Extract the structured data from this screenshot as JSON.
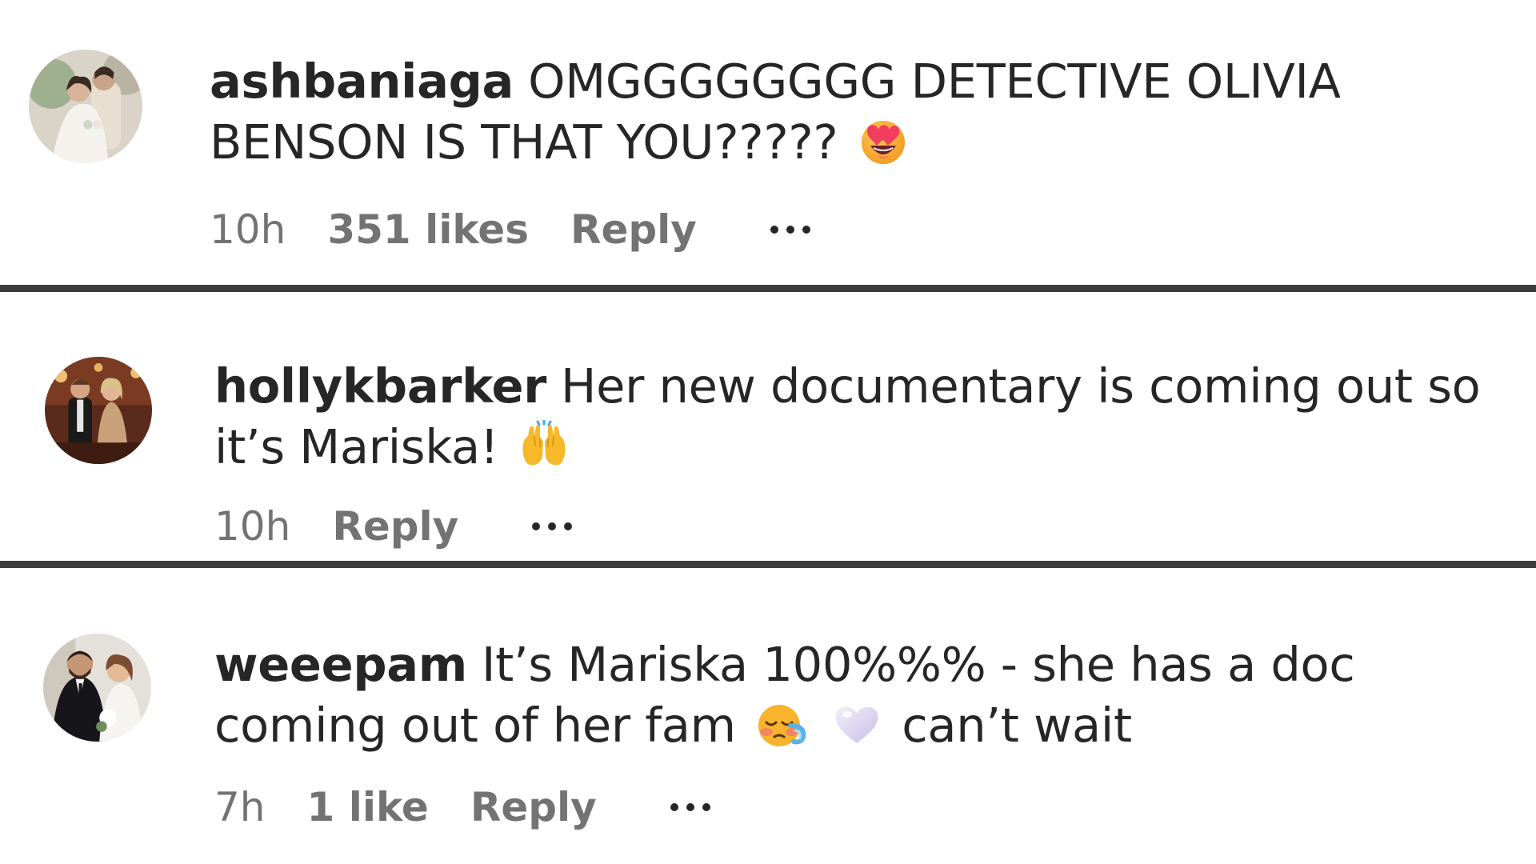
{
  "comments": [
    {
      "username": "ashbaniaga",
      "text_before": "OMGGGGGGGG DETECTIVE OLIVIA BENSON IS THAT YOU?????",
      "emojis": [
        "heart-eyes-emoji"
      ],
      "text_after": "",
      "time": "10h",
      "likes": "351 likes",
      "reply": "Reply"
    },
    {
      "username": "hollykbarker",
      "text_before": "Her new documentary is coming out so it’s Mariska!",
      "emojis": [
        "raising-hands-emoji"
      ],
      "text_after": "",
      "time": "10h",
      "likes": "",
      "reply": "Reply"
    },
    {
      "username": "weeepam",
      "text_before": "It’s Mariska 100%%% - she has a doc coming out of her fam",
      "emojis": [
        "face-holding-back-tears-emoji",
        "white-heart-emoji"
      ],
      "text_after": "can’t wait",
      "time": "7h",
      "likes": "1 like",
      "reply": "Reply"
    }
  ],
  "colors": {
    "text": "#262626",
    "meta": "#737373",
    "divider": "#3d3d3d",
    "background": "#ffffff"
  }
}
